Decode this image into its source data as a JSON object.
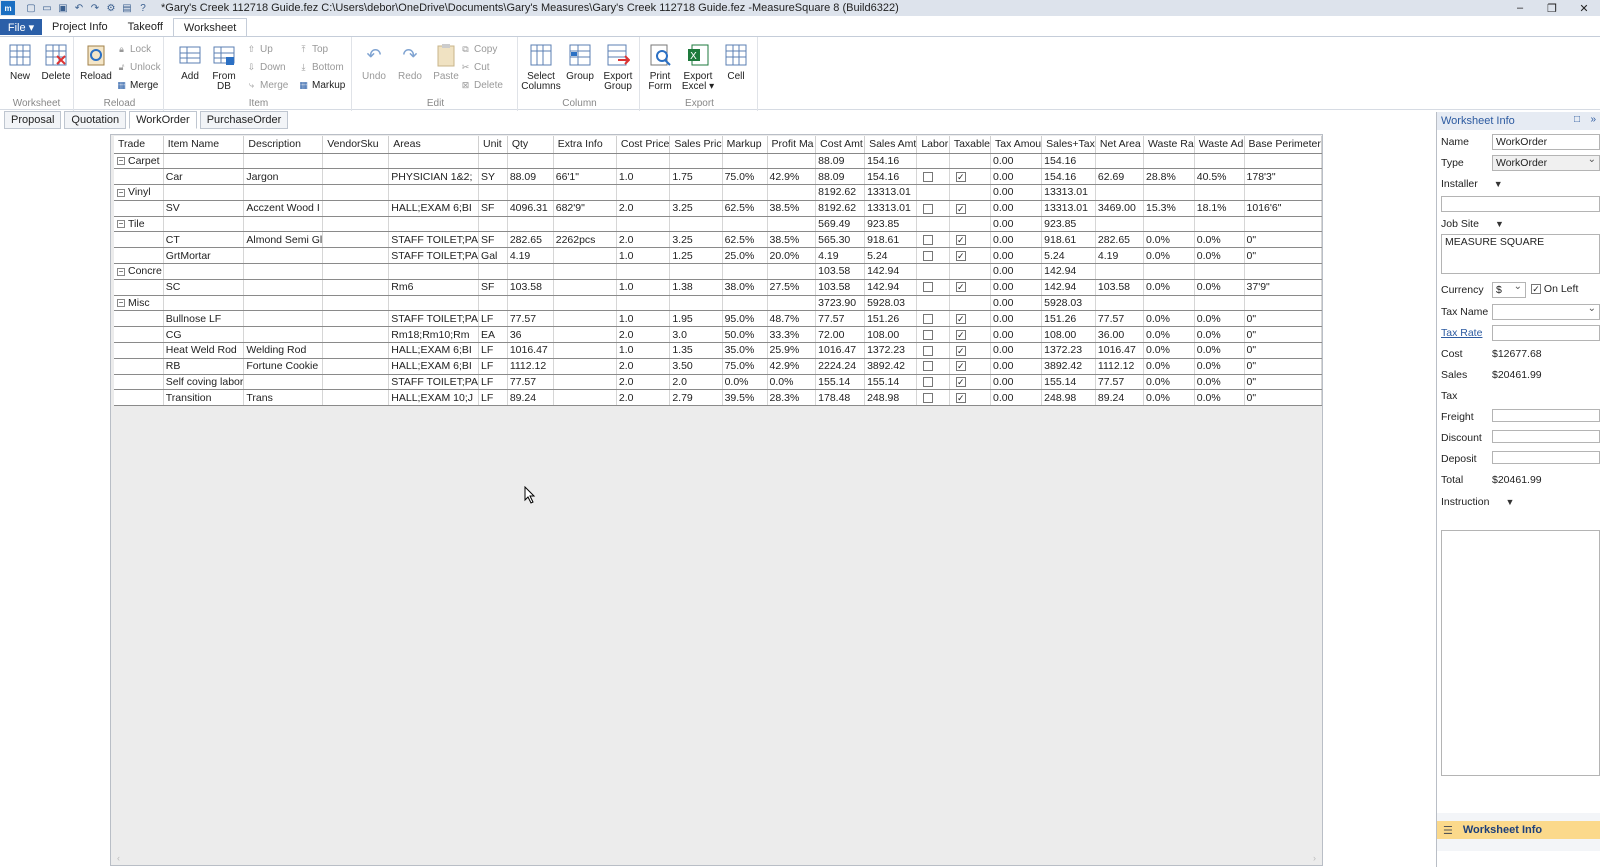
{
  "window": {
    "title": "*Gary's Creek 112718 Guide.fez C:\\Users\\debor\\OneDrive\\Documents\\Gary's Measures\\Gary's Creek 112718 Guide.fez -MeasureSquare 8 (Build6322)",
    "minimize": "–",
    "restore": "❐",
    "close": "✕"
  },
  "ribbon_tabs": {
    "file": "File ▾",
    "project_info": "Project Info",
    "takeoff": "Takeoff",
    "worksheet": "Worksheet"
  },
  "ribbon": {
    "worksheet": {
      "label": "Worksheet",
      "new": "New",
      "delete": "Delete"
    },
    "reload": {
      "label": "Reload",
      "reload": "Reload",
      "lock": "Lock",
      "unlock": "Unlock",
      "merge": "Merge"
    },
    "item": {
      "label": "Item",
      "add": "Add",
      "from_db": "From DB",
      "up": "Up",
      "down": "Down",
      "merge": "Merge",
      "top": "Top",
      "bottom": "Bottom",
      "markup": "Markup"
    },
    "edit": {
      "label": "Edit",
      "undo": "Undo",
      "redo": "Redo",
      "paste": "Paste",
      "copy": "Copy",
      "cut": "Cut",
      "delete": "Delete"
    },
    "column": {
      "label": "Column",
      "select_columns": "Select Columns",
      "group": "Group",
      "export_group": "Export Group"
    },
    "export": {
      "label": "Export",
      "print_form": "Print Form",
      "export_excel": "Export Excel ▾",
      "cell": "Cell"
    }
  },
  "doc_tabs": [
    "Proposal",
    "Quotation",
    "WorkOrder",
    "PurchaseOrder"
  ],
  "grid": {
    "columns": [
      "Trade",
      "Item Name",
      "Description",
      "VendorSku",
      "Areas",
      "Unit",
      "Qty",
      "Extra Info",
      "Cost Price",
      "Sales Pric",
      "Markup",
      "Profit Ma",
      "Cost Amt",
      "Sales Amt",
      "Labor",
      "Taxable",
      "Tax Amou",
      "Sales+Tax",
      "Net Area",
      "Waste Ra",
      "Waste Ad",
      "Base Perimeter"
    ],
    "rows": [
      {
        "group": true,
        "trade": "Carpet",
        "cost_amt": "88.09",
        "sales_amt": "154.16",
        "tax": "0.00",
        "sales_tax": "154.16"
      },
      {
        "item": "Car",
        "desc": "Jargon",
        "sku": "",
        "areas": "PHYSICIAN 1&2;",
        "unit": "SY",
        "qty": "88.09",
        "extra": "66'1\"",
        "cost_price": "1.0",
        "sales_price": "1.75",
        "markup": "75.0%",
        "profit": "42.9%",
        "cost_amt": "88.09",
        "sales_amt": "154.16",
        "labor": false,
        "taxable": true,
        "tax": "0.00",
        "sales_tax": "154.16",
        "net": "62.69",
        "waste_rate": "28.8%",
        "waste_add": "40.5%",
        "perimeter": "178'3\""
      },
      {
        "group": true,
        "trade": "Vinyl",
        "cost_amt": "8192.62",
        "sales_amt": "13313.01",
        "tax": "0.00",
        "sales_tax": "13313.01"
      },
      {
        "item": "SV",
        "desc": "Acczent Wood  I",
        "sku": "",
        "areas": "HALL;EXAM 6;BI",
        "unit": "SF",
        "qty": "4096.31",
        "extra": "682'9\"",
        "cost_price": "2.0",
        "sales_price": "3.25",
        "markup": "62.5%",
        "profit": "38.5%",
        "cost_amt": "8192.62",
        "sales_amt": "13313.01",
        "labor": false,
        "taxable": true,
        "tax": "0.00",
        "sales_tax": "13313.01",
        "net": "3469.00",
        "waste_rate": "15.3%",
        "waste_add": "18.1%",
        "perimeter": "1016'6\""
      },
      {
        "group": true,
        "trade": "Tile",
        "cost_amt": "569.49",
        "sales_amt": "923.85",
        "tax": "0.00",
        "sales_tax": "923.85"
      },
      {
        "item": "CT",
        "desc": "Almond Semi Gl",
        "sku": "",
        "areas": "STAFF TOILET;PA",
        "unit": "SF",
        "qty": "282.65",
        "extra": "2262pcs",
        "cost_price": "2.0",
        "sales_price": "3.25",
        "markup": "62.5%",
        "profit": "38.5%",
        "cost_amt": "565.30",
        "sales_amt": "918.61",
        "labor": false,
        "taxable": true,
        "tax": "0.00",
        "sales_tax": "918.61",
        "net": "282.65",
        "waste_rate": "0.0%",
        "waste_add": "0.0%",
        "perimeter": "0\""
      },
      {
        "item": "GrtMortar",
        "desc": "",
        "sku": "",
        "areas": "STAFF TOILET;PA",
        "unit": "Gal",
        "qty": "4.19",
        "extra": "",
        "cost_price": "1.0",
        "sales_price": "1.25",
        "markup": "25.0%",
        "profit": "20.0%",
        "cost_amt": "4.19",
        "sales_amt": "5.24",
        "labor": false,
        "taxable": true,
        "tax": "0.00",
        "sales_tax": "5.24",
        "net": "4.19",
        "waste_rate": "0.0%",
        "waste_add": "0.0%",
        "perimeter": "0\""
      },
      {
        "group": true,
        "trade": "Concre",
        "cost_amt": "103.58",
        "sales_amt": "142.94",
        "tax": "0.00",
        "sales_tax": "142.94"
      },
      {
        "item": "SC",
        "desc": "",
        "sku": "",
        "areas": "Rm6",
        "unit": "SF",
        "qty": "103.58",
        "extra": "",
        "cost_price": "1.0",
        "sales_price": "1.38",
        "markup": "38.0%",
        "profit": "27.5%",
        "cost_amt": "103.58",
        "sales_amt": "142.94",
        "labor": false,
        "taxable": true,
        "tax": "0.00",
        "sales_tax": "142.94",
        "net": "103.58",
        "waste_rate": "0.0%",
        "waste_add": "0.0%",
        "perimeter": "37'9\""
      },
      {
        "group": true,
        "trade": "Misc",
        "cost_amt": "3723.90",
        "sales_amt": "5928.03",
        "tax": "0.00",
        "sales_tax": "5928.03"
      },
      {
        "item": "Bullnose LF",
        "desc": "",
        "sku": "",
        "areas": "STAFF TOILET;PA",
        "unit": "LF",
        "qty": "77.57",
        "extra": "",
        "cost_price": "1.0",
        "sales_price": "1.95",
        "markup": "95.0%",
        "profit": "48.7%",
        "cost_amt": "77.57",
        "sales_amt": "151.26",
        "labor": false,
        "taxable": true,
        "tax": "0.00",
        "sales_tax": "151.26",
        "net": "77.57",
        "waste_rate": "0.0%",
        "waste_add": "0.0%",
        "perimeter": "0\""
      },
      {
        "item": "CG",
        "desc": "",
        "sku": "",
        "areas": "Rm18;Rm10;Rm",
        "unit": "EA",
        "qty": "36",
        "extra": "",
        "cost_price": "2.0",
        "sales_price": "3.0",
        "markup": "50.0%",
        "profit": "33.3%",
        "cost_amt": "72.00",
        "sales_amt": "108.00",
        "labor": false,
        "taxable": true,
        "tax": "0.00",
        "sales_tax": "108.00",
        "net": "36.00",
        "waste_rate": "0.0%",
        "waste_add": "0.0%",
        "perimeter": "0\""
      },
      {
        "item": "Heat Weld Rod",
        "desc": "Welding Rod",
        "sku": "",
        "areas": "HALL;EXAM 6;BI",
        "unit": "LF",
        "qty": "1016.47",
        "extra": "",
        "cost_price": "1.0",
        "sales_price": "1.35",
        "markup": "35.0%",
        "profit": "25.9%",
        "cost_amt": "1016.47",
        "sales_amt": "1372.23",
        "labor": false,
        "taxable": true,
        "tax": "0.00",
        "sales_tax": "1372.23",
        "net": "1016.47",
        "waste_rate": "0.0%",
        "waste_add": "0.0%",
        "perimeter": "0\""
      },
      {
        "item": "RB",
        "desc": "Fortune Cookie",
        "sku": "",
        "areas": "HALL;EXAM 6;BI",
        "unit": "LF",
        "qty": "1112.12",
        "extra": "",
        "cost_price": "2.0",
        "sales_price": "3.50",
        "markup": "75.0%",
        "profit": "42.9%",
        "cost_amt": "2224.24",
        "sales_amt": "3892.42",
        "labor": false,
        "taxable": true,
        "tax": "0.00",
        "sales_tax": "3892.42",
        "net": "1112.12",
        "waste_rate": "0.0%",
        "waste_add": "0.0%",
        "perimeter": "0\""
      },
      {
        "item": "Self coving labor",
        "desc": "",
        "sku": "",
        "areas": "STAFF TOILET;PA",
        "unit": "LF",
        "qty": "77.57",
        "extra": "",
        "cost_price": "2.0",
        "sales_price": "2.0",
        "markup": "0.0%",
        "profit": "0.0%",
        "cost_amt": "155.14",
        "sales_amt": "155.14",
        "labor": false,
        "taxable": true,
        "tax": "0.00",
        "sales_tax": "155.14",
        "net": "77.57",
        "waste_rate": "0.0%",
        "waste_add": "0.0%",
        "perimeter": "0\""
      },
      {
        "item": "Transition",
        "desc": "Trans",
        "sku": "",
        "areas": "HALL;EXAM 10;J",
        "unit": "LF",
        "qty": "89.24",
        "extra": "",
        "cost_price": "2.0",
        "sales_price": "2.79",
        "markup": "39.5%",
        "profit": "28.3%",
        "cost_amt": "178.48",
        "sales_amt": "248.98",
        "labor": false,
        "taxable": true,
        "tax": "0.00",
        "sales_tax": "248.98",
        "net": "89.24",
        "waste_rate": "0.0%",
        "waste_add": "0.0%",
        "perimeter": "0\""
      }
    ]
  },
  "panel": {
    "title": "Worksheet Info",
    "name_label": "Name",
    "name_value": "WorkOrder",
    "type_label": "Type",
    "type_value": "WorkOrder",
    "installer_label": "Installer",
    "job_site_label": "Job Site",
    "job_site_value": "MEASURE SQUARE",
    "currency_label": "Currency",
    "currency_value": "$",
    "on_left_label": "On Left",
    "tax_name_label": "Tax Name",
    "tax_rate_label": "Tax Rate",
    "cost_label": "Cost",
    "cost_value": "$12677.68",
    "sales_label": "Sales",
    "sales_value": "$20461.99",
    "tax_label": "Tax",
    "freight_label": "Freight",
    "discount_label": "Discount",
    "deposit_label": "Deposit",
    "total_label": "Total",
    "total_value": "$20461.99",
    "instruction_label": "Instruction",
    "bottom_tab": "Worksheet Info"
  }
}
